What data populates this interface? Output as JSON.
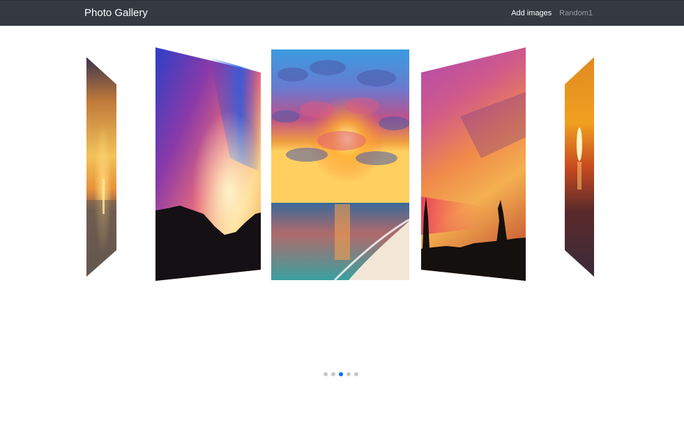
{
  "navbar": {
    "brand": "Photo Gallery",
    "links": [
      {
        "label": "Add images",
        "active": true
      },
      {
        "label": "Random1",
        "active": false
      }
    ]
  },
  "carousel": {
    "active_index": 2,
    "slide_count": 5,
    "slides": [
      {
        "subject": "sunset over sea, vertical sun reflection"
      },
      {
        "subject": "swirling purple and orange sky over dark mountains"
      },
      {
        "subject": "sunset clouds over beach with waves"
      },
      {
        "subject": "pink and orange sky with tree silhouettes"
      },
      {
        "subject": "orange sunset over water"
      }
    ]
  },
  "colors": {
    "navbar_bg": "#343a40",
    "dot_active": "#0d6efd",
    "dot_inactive": "#c8c8c8"
  }
}
